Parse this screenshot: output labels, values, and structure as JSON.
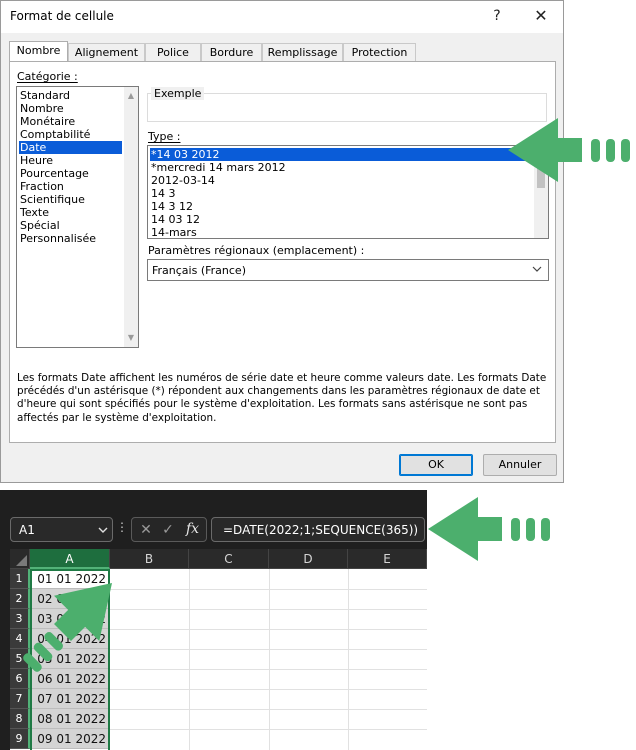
{
  "dialog": {
    "title": "Format de cellule",
    "help_label": "?",
    "close_label": "✕",
    "tabs": [
      "Nombre",
      "Alignement",
      "Police",
      "Bordure",
      "Remplissage",
      "Protection"
    ],
    "category_label": "Catégorie :",
    "categories": [
      "Standard",
      "Nombre",
      "Monétaire",
      "Comptabilité",
      "Date",
      "Heure",
      "Pourcentage",
      "Fraction",
      "Scientifique",
      "Texte",
      "Spécial",
      "Personnalisée"
    ],
    "selected_category": "Date",
    "sample_label": "Exemple",
    "type_label": "Type :",
    "types": [
      "*14 03 2012",
      "*mercredi 14 mars 2012",
      "2012-03-14",
      "14 3",
      "14 3 12",
      "14 03 12",
      "14-mars"
    ],
    "selected_type": "*14 03 2012",
    "locale_label": "Paramètres régionaux (emplacement) :",
    "locale_value": "Français (France)",
    "description": "Les formats Date affichent les numéros de série date et heure comme valeurs date. Les formats Date précédés d'un astérisque (*) répondent aux changements dans les paramètres régionaux de date et d'heure qui sont spécifiés pour le système d'exploitation. Les formats sans astérisque ne sont pas affectés par le système d'exploitation.",
    "ok_label": "OK",
    "cancel_label": "Annuler"
  },
  "excel": {
    "name_box": "A1",
    "fx_label": "fx",
    "formula": "=DATE(2022;1;SEQUENCE(365))",
    "columns": [
      "A",
      "B",
      "C",
      "D",
      "E"
    ],
    "rows": [
      {
        "num": "1",
        "a": "01 01 2022"
      },
      {
        "num": "2",
        "a": "02 01 2022"
      },
      {
        "num": "3",
        "a": "03 01 2022"
      },
      {
        "num": "4",
        "a": "04 01 2022"
      },
      {
        "num": "5",
        "a": "05 01 2022"
      },
      {
        "num": "6",
        "a": "06 01 2022"
      },
      {
        "num": "7",
        "a": "07 01 2022"
      },
      {
        "num": "8",
        "a": "08 01 2022"
      },
      {
        "num": "9",
        "a": "09 01 2022"
      }
    ]
  },
  "colors": {
    "selection_blue": "#0a5cd8",
    "arrow_green": "#4caf6d",
    "excel_green": "#1f7a45"
  }
}
